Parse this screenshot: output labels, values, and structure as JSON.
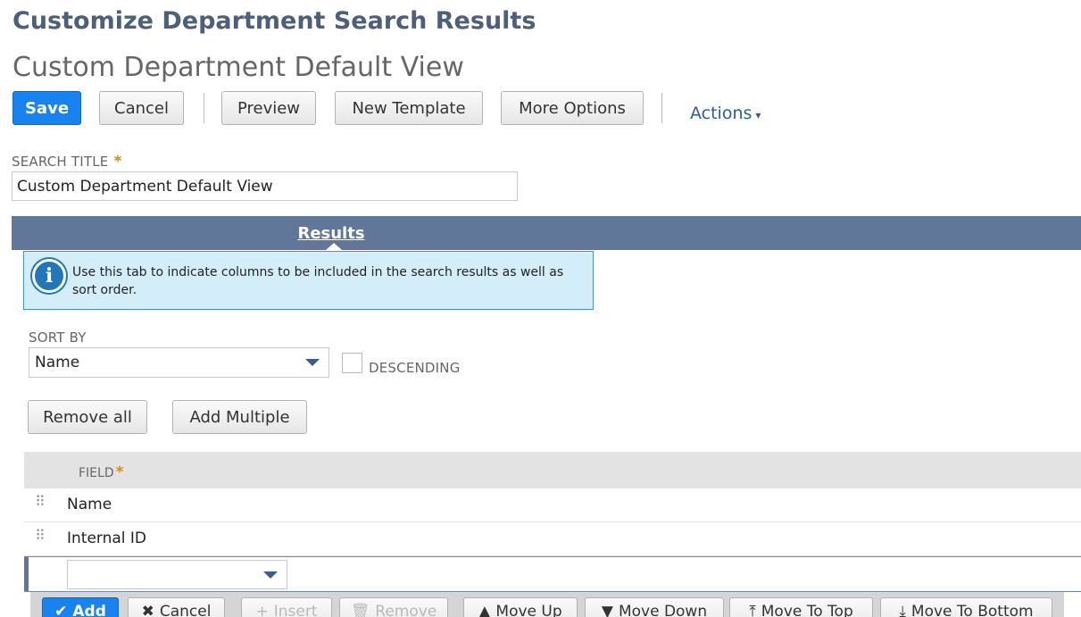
{
  "header": {
    "page_heading": "Customize Department Search Results",
    "record_title": "Custom Department Default View"
  },
  "toolbar": {
    "save": "Save",
    "cancel": "Cancel",
    "preview": "Preview",
    "new_template": "New Template",
    "more_options": "More Options",
    "actions": "Actions",
    "actions_caret": "▾"
  },
  "search_title": {
    "label": "SEARCH TITLE",
    "required_mark": "*",
    "value": "Custom Department Default View"
  },
  "tabs": {
    "results": "Results"
  },
  "info": {
    "icon": "i",
    "text": "Use this tab to indicate columns to be included in the search results as well as sort order."
  },
  "sort": {
    "label": "SORT BY",
    "value": "Name",
    "descending_label": "DESCENDING",
    "descending_checked": false
  },
  "buttons": {
    "remove_all": "Remove all",
    "add_multiple": "Add Multiple"
  },
  "grid": {
    "column_label": "FIELD",
    "required_mark": "*",
    "rows": [
      {
        "field": "Name"
      },
      {
        "field": "Internal ID"
      }
    ],
    "new_row_value": ""
  },
  "grid_toolbar": {
    "add": "Add",
    "add_icon": "✔",
    "cancel": "Cancel",
    "cancel_icon": "✖",
    "insert": "Insert",
    "insert_icon": "+",
    "remove": "Remove",
    "remove_icon": "🗑",
    "move_up": "Move Up",
    "move_up_icon": "▲",
    "move_down": "Move Down",
    "move_down_icon": "▼",
    "move_to_top": "Move To Top",
    "move_to_top_icon": "⤒",
    "move_to_bottom": "Move To Bottom",
    "move_to_bottom_icon": "⤓"
  },
  "colors": {
    "primary_button": "#1883ef",
    "tab_bar": "#607799",
    "heading": "#4d5f79",
    "required": "#d38b1b",
    "info_background": "#d4eef9"
  }
}
